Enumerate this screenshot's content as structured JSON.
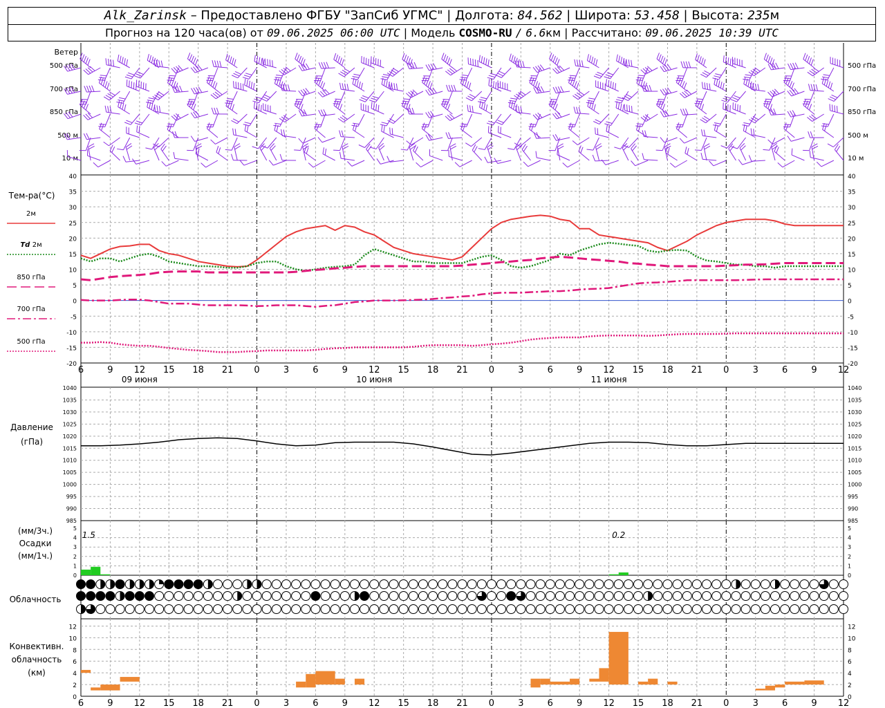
{
  "header": {
    "station": "Alk_Zarinsk",
    "dash": "–",
    "provider": "Предоставлено ФГБУ \"ЗапСиб УГМС\"",
    "lon_label": "Долгота:",
    "lon_value": "84.562",
    "lat_label": "Широта:",
    "lat_value": "53.458",
    "alt_label": "Высота:",
    "alt_value": "235",
    "alt_unit": "м",
    "forecast_label": "Прогноз на 120 часа(ов) от",
    "forecast_from": "09.06.2025 06:00 UTC",
    "model_label": "Модель",
    "model_name": "COSMO-RU",
    "model_res": "6.6",
    "model_res_unit": "км",
    "computed_label": "Рассчитано:",
    "computed_value": "09.06.2025 10:39 UTC",
    "sep": "|"
  },
  "wind_panel": {
    "title": "Ветер",
    "levels": [
      "500 гПа",
      "700 гПа",
      "850 гПа",
      "500 м",
      "10 м"
    ],
    "color": "#8a2be2"
  },
  "temp_panel": {
    "title": "Тем-ра(°C)",
    "ticks": [
      "40",
      "35",
      "30",
      "25",
      "20",
      "15",
      "10",
      "5",
      "0",
      "-5",
      "-10",
      "-15",
      "-20"
    ],
    "legend": [
      {
        "label": "2м",
        "label_prefix": "",
        "color": "#e83a3a",
        "style": "solid"
      },
      {
        "label": "2м",
        "label_prefix": "Td",
        "color": "#1a8a1a",
        "style": "dotted"
      },
      {
        "label": "850 гПа",
        "label_prefix": "",
        "color": "#e0187a",
        "style": "dashed"
      },
      {
        "label": "700 гПа",
        "label_prefix": "",
        "color": "#e0187a",
        "style": "dashdot"
      },
      {
        "label": "500 гПа",
        "label_prefix": "",
        "color": "#e0187a",
        "style": "dotted"
      }
    ]
  },
  "time_axis": {
    "hour_labels": [
      "6",
      "9",
      "12",
      "15",
      "18",
      "21",
      "0",
      "3",
      "6",
      "9",
      "12",
      "15",
      "18",
      "21",
      "0",
      "3",
      "6",
      "9",
      "12",
      "15",
      "18",
      "21",
      "0",
      "3",
      "6",
      "9",
      "12"
    ],
    "day_labels": [
      "09 июня",
      "10 июня",
      "11 июня"
    ]
  },
  "pressure_panel": {
    "title": "Давление",
    "unit": "(гПа)",
    "ticks": [
      "1040",
      "1035",
      "1030",
      "1025",
      "1020",
      "1015",
      "1010",
      "1005",
      "1000",
      "995",
      "990",
      "985"
    ]
  },
  "precip_panel": {
    "unit3": "(мм/3ч.)",
    "title": "Осадки",
    "unit1": "(мм/1ч.)",
    "ticks": [
      "5",
      "4",
      "3",
      "2",
      "1",
      "0"
    ],
    "totals": [
      {
        "text": "1.5"
      },
      {
        "text": "0.2"
      }
    ],
    "color": "#22cc22"
  },
  "cloud_panel": {
    "title": "Облачность",
    "rows": [
      "8854845428888400044000000000000000000000000000000000000000000000000400040000600000000000000000000000000000000000000000000000000000000000000000000006000000000000000000000000000000000000000000040088888888888888",
      "8888488800000000400000008000480000000000060086000000000000400000000000000000000000000000000000000000000000000000000000000000000000000000000000000000000000000000000000000000000000000000000",
      "4600000000000000000000000000000000000000000000000000000000000000000000000000000000000000000000000000000000000000000000000000000000000000000000000000000000000000000000000000000000000000000"
    ]
  },
  "conv_panel": {
    "title1": "Конвективн.",
    "title2": "облачность",
    "unit": "(км)",
    "ticks": [
      "12",
      "10",
      "8",
      "6",
      "4",
      "2",
      "0"
    ],
    "color": "#ee8833"
  },
  "chart_data": [
    {
      "type": "line",
      "title": "Тем-ра(°C)",
      "x_hours_from_start": [
        0,
        1,
        2,
        3,
        4,
        5,
        6,
        7,
        8,
        9,
        10,
        11,
        12,
        13,
        14,
        15,
        16,
        17,
        18,
        19,
        20,
        21,
        22,
        23,
        24,
        25,
        26,
        27,
        28,
        29,
        30,
        31,
        32,
        33,
        34,
        35,
        36,
        37,
        38,
        39,
        40,
        41,
        42,
        43,
        44,
        45,
        46,
        47,
        48,
        49,
        50,
        51,
        52,
        53,
        54,
        55,
        56,
        57,
        58,
        59,
        60,
        61,
        62,
        63,
        64,
        65,
        66,
        67,
        68,
        69,
        70,
        71,
        72,
        73,
        74,
        75,
        76,
        77,
        78
      ],
      "ylim": [
        -20,
        40
      ],
      "series": [
        {
          "name": "2м",
          "values": [
            14.5,
            13.5,
            15,
            16.5,
            17.3,
            17.5,
            18,
            18,
            16,
            15,
            14.5,
            13.5,
            12.5,
            12,
            11.5,
            11,
            10.8,
            11,
            13,
            15.5,
            18,
            20.5,
            22,
            23,
            23.5,
            24,
            22.5,
            24,
            23.5,
            22,
            21,
            19,
            17,
            16,
            15,
            14.5,
            14,
            13.5,
            13,
            14,
            17,
            20,
            23,
            25,
            26,
            26.5,
            27,
            27.3,
            27,
            26,
            25.5,
            23,
            23,
            21,
            20.5,
            20,
            19.5,
            19,
            18.5,
            17,
            16,
            17.5,
            19,
            21,
            22.5,
            24,
            25,
            25.5,
            26,
            26,
            26,
            25.5,
            24.5,
            24,
            24,
            24,
            24,
            24,
            24
          ]
        },
        {
          "name": "Td 2м",
          "values": [
            13.5,
            12.5,
            13.5,
            13.5,
            12.5,
            13.5,
            14.5,
            15,
            14,
            12.5,
            12,
            11.5,
            11,
            11,
            10.8,
            10.5,
            10.5,
            11,
            12,
            12.5,
            12.5,
            11,
            10,
            9.5,
            10,
            10.5,
            10.8,
            11,
            11.5,
            14.5,
            16.5,
            15.5,
            14.5,
            13.5,
            12.5,
            12.5,
            12,
            12,
            12,
            12,
            13,
            14,
            14.5,
            13,
            11,
            10.5,
            11,
            12,
            13,
            15,
            14.5,
            16,
            17,
            18,
            18.5,
            18.2,
            17.8,
            17.5,
            16,
            15.5,
            16,
            16.2,
            16,
            14,
            12.8,
            12.5,
            12,
            11.5,
            11.5,
            11,
            11,
            10.5,
            11,
            11,
            11,
            11,
            11,
            11,
            11
          ]
        },
        {
          "name": "850 гПа",
          "values": [
            6.8,
            6.5,
            7,
            7.5,
            7.8,
            8,
            8.2,
            8.5,
            9,
            9.2,
            9.3,
            9.3,
            9.3,
            9,
            9,
            9,
            9,
            9,
            9,
            9,
            9,
            9,
            9.2,
            9.5,
            9.8,
            10,
            10.3,
            10.5,
            10.8,
            11,
            11,
            11,
            11,
            11,
            11,
            11,
            11,
            11,
            11,
            11.2,
            11.5,
            11.7,
            12,
            12.3,
            12.5,
            12.8,
            13,
            13.5,
            13.8,
            14,
            13.8,
            13.5,
            13.2,
            13,
            12.7,
            12.5,
            12,
            11.8,
            11.5,
            11.3,
            11,
            11,
            11,
            11,
            11,
            11,
            11.2,
            11.3,
            11.5,
            11.5,
            11.6,
            11.8,
            12,
            12,
            12,
            12,
            12,
            12,
            12
          ]
        },
        {
          "name": "700 гПа",
          "values": [
            0.2,
            0,
            0,
            0,
            0.2,
            0.3,
            0.3,
            0,
            -0.5,
            -1,
            -1,
            -1,
            -1.3,
            -1.5,
            -1.5,
            -1.5,
            -1.5,
            -1.6,
            -1.8,
            -1.7,
            -1.5,
            -1.5,
            -1.5,
            -1.8,
            -2,
            -1.7,
            -1.5,
            -1,
            -0.5,
            -0.3,
            0,
            0,
            0,
            0.1,
            0.2,
            0.3,
            0.5,
            0.8,
            1,
            1.3,
            1.5,
            2,
            2.3,
            2.5,
            2.5,
            2.5,
            2.7,
            2.8,
            3,
            3,
            3.2,
            3.5,
            3.7,
            3.8,
            4,
            4.5,
            5,
            5.5,
            5.7,
            5.8,
            6,
            6.2,
            6.5,
            6.5,
            6.5,
            6.5,
            6.5,
            6.5,
            6.6,
            6.7,
            6.8,
            6.8,
            6.8,
            6.8,
            6.8,
            6.8,
            6.8,
            6.8,
            6.8
          ]
        },
        {
          "name": "500 гПа",
          "values": [
            -13.5,
            -13.5,
            -13.3,
            -13.5,
            -14,
            -14.3,
            -14.5,
            -14.5,
            -14.8,
            -15.2,
            -15.5,
            -15.8,
            -16,
            -16.2,
            -16.5,
            -16.5,
            -16.5,
            -16.3,
            -16.2,
            -16,
            -16,
            -16,
            -16,
            -16,
            -15.8,
            -15.5,
            -15.3,
            -15.2,
            -15,
            -15,
            -15,
            -15,
            -15,
            -15,
            -14.8,
            -14.5,
            -14.3,
            -14.3,
            -14.3,
            -14.3,
            -14.5,
            -14.3,
            -14,
            -13.8,
            -13.5,
            -13,
            -12.5,
            -12.2,
            -12,
            -11.8,
            -11.8,
            -11.8,
            -11.5,
            -11.3,
            -11.2,
            -11.2,
            -11.2,
            -11.2,
            -11.3,
            -11.2,
            -11,
            -10.8,
            -10.7,
            -10.7,
            -10.7,
            -10.7,
            -10.6,
            -10.5,
            -10.5,
            -10.5,
            -10.5,
            -10.5,
            -10.5,
            -10.5,
            -10.5,
            -10.5,
            -10.5,
            -10.5,
            -10.5
          ]
        }
      ]
    },
    {
      "type": "line",
      "title": "Давление",
      "x_hours_from_start": [
        0,
        2,
        4,
        6,
        8,
        10,
        12,
        14,
        16,
        18,
        20,
        22,
        24,
        26,
        28,
        30,
        32,
        34,
        36,
        38,
        40,
        42,
        44,
        46,
        48,
        50,
        52,
        54,
        56,
        58,
        60,
        62,
        64,
        66,
        68,
        70,
        72,
        74,
        76,
        78
      ],
      "ylim": [
        985,
        1040
      ],
      "series": [
        {
          "name": "Давление",
          "values": [
            1016,
            1016,
            1016.3,
            1016.8,
            1017.5,
            1018.5,
            1019,
            1019.3,
            1019,
            1018,
            1016.8,
            1016,
            1016.3,
            1017.3,
            1017.5,
            1017.5,
            1017.5,
            1016.8,
            1015.5,
            1014,
            1012.5,
            1012.2,
            1013,
            1014,
            1015,
            1016,
            1017,
            1017.5,
            1017.5,
            1017.3,
            1016.5,
            1016,
            1016,
            1016.5,
            1017,
            1017,
            1017,
            1017,
            1017,
            1017
          ]
        }
      ]
    },
    {
      "type": "bar",
      "title": "Осадки",
      "ylim": [
        0,
        5
      ],
      "series": [
        {
          "name": "мм/1ч.",
          "bars": [
            {
              "x": 0,
              "value": 0.6
            },
            {
              "x": 1,
              "value": 0.9
            },
            {
              "x": 2,
              "value": 0.1
            },
            {
              "x": 54,
              "value": 0.1
            },
            {
              "x": 55,
              "value": 0.3
            }
          ]
        }
      ]
    },
    {
      "type": "bar",
      "title": "Конвективн. облачность",
      "ylim": [
        0,
        13
      ],
      "series": [
        {
          "name": "км",
          "bars": [
            {
              "x0": 0,
              "x1": 1,
              "bottom": 4,
              "top": 4.5
            },
            {
              "x0": 1,
              "x1": 2,
              "bottom": 1,
              "top": 1.5
            },
            {
              "x0": 2,
              "x1": 4,
              "bottom": 1,
              "top": 2
            },
            {
              "x0": 4,
              "x1": 6,
              "bottom": 2.5,
              "top": 3.3
            },
            {
              "x0": 22,
              "x1": 23,
              "bottom": 1.5,
              "top": 2.5
            },
            {
              "x0": 23,
              "x1": 24,
              "bottom": 1.5,
              "top": 3.8
            },
            {
              "x0": 24,
              "x1": 26,
              "bottom": 2,
              "top": 4.3
            },
            {
              "x0": 26,
              "x1": 27,
              "bottom": 2,
              "top": 3
            },
            {
              "x0": 28,
              "x1": 29,
              "bottom": 2,
              "top": 3
            },
            {
              "x0": 46,
              "x1": 47,
              "bottom": 1.5,
              "top": 3
            },
            {
              "x0": 47,
              "x1": 48,
              "bottom": 2,
              "top": 3
            },
            {
              "x0": 48,
              "x1": 50,
              "bottom": 2,
              "top": 2.5
            },
            {
              "x0": 50,
              "x1": 51,
              "bottom": 2,
              "top": 3
            },
            {
              "x0": 52,
              "x1": 53,
              "bottom": 2.5,
              "top": 3
            },
            {
              "x0": 53,
              "x1": 54,
              "bottom": 2.5,
              "top": 4.8
            },
            {
              "x0": 54,
              "x1": 56,
              "bottom": 2,
              "top": 11
            },
            {
              "x0": 57,
              "x1": 58,
              "bottom": 2,
              "top": 2.5
            },
            {
              "x0": 58,
              "x1": 59,
              "bottom": 2,
              "top": 3
            },
            {
              "x0": 60,
              "x1": 61,
              "bottom": 2,
              "top": 2.5
            },
            {
              "x0": 69,
              "x1": 70,
              "bottom": 1,
              "top": 1.3
            },
            {
              "x0": 70,
              "x1": 71,
              "bottom": 1,
              "top": 1.8
            },
            {
              "x0": 71,
              "x1": 72,
              "bottom": 1.5,
              "top": 2
            },
            {
              "x0": 72,
              "x1": 74,
              "bottom": 2,
              "top": 2.5
            },
            {
              "x0": 74,
              "x1": 76,
              "bottom": 2,
              "top": 2.7
            }
          ]
        }
      ]
    }
  ]
}
